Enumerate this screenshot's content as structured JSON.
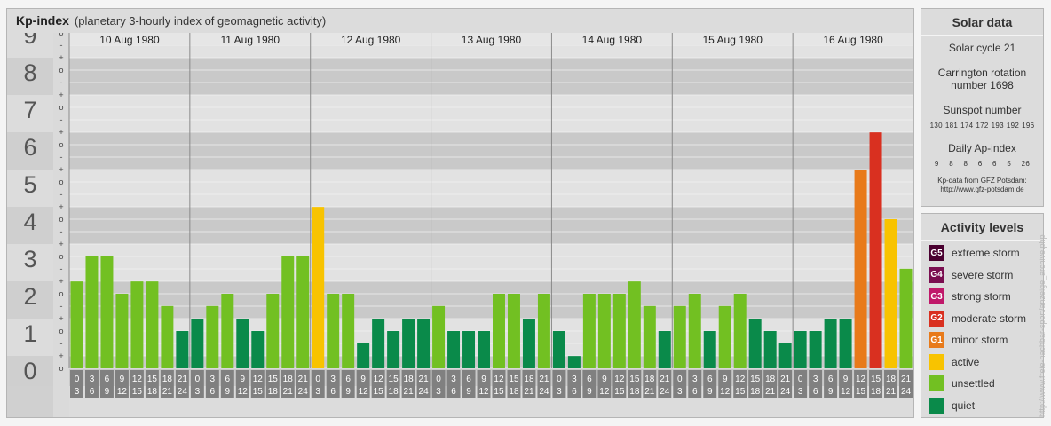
{
  "header": {
    "title": "Kp-index",
    "subtitle": "(planetary 3-hourly index of geomagnetic activity)"
  },
  "chart_data": {
    "type": "bar",
    "title": "Kp-index",
    "subtitle": "(planetary 3-hourly index of geomagnetic activity)",
    "y_major_labels": [
      "0",
      "1",
      "2",
      "3",
      "4",
      "5",
      "6",
      "7",
      "8",
      "9"
    ],
    "y_minor_marks": [
      "-",
      "o",
      "+"
    ],
    "ylim": [
      0,
      9.33
    ],
    "dates": [
      "10 Aug 1980",
      "11 Aug 1980",
      "12 Aug 1980",
      "13 Aug 1980",
      "14 Aug 1980",
      "15 Aug 1980",
      "16 Aug 1980"
    ],
    "interval_top_labels": [
      "0",
      "3",
      "6",
      "9",
      "12",
      "15",
      "18",
      "21"
    ],
    "interval_bottom_labels": [
      "3",
      "6",
      "9",
      "12",
      "15",
      "18",
      "21",
      "24"
    ],
    "values": [
      [
        2.33,
        3.0,
        3.0,
        2.0,
        2.33,
        2.33,
        1.67,
        1.0
      ],
      [
        1.33,
        1.67,
        2.0,
        1.33,
        1.0,
        2.0,
        3.0,
        3.0
      ],
      [
        4.33,
        2.0,
        2.0,
        0.67,
        1.33,
        1.0,
        1.33,
        1.33
      ],
      [
        1.67,
        1.0,
        1.0,
        1.0,
        2.0,
        2.0,
        1.33,
        2.0
      ],
      [
        1.0,
        0.33,
        2.0,
        2.0,
        2.0,
        2.33,
        1.67,
        1.0
      ],
      [
        1.67,
        2.0,
        1.0,
        1.67,
        2.0,
        1.33,
        1.0,
        0.67
      ],
      [
        1.0,
        1.0,
        1.33,
        1.33,
        5.33,
        6.33,
        4.0,
        2.67
      ]
    ],
    "level_colors": {
      "quiet": "#0a8a4a",
      "unsettled": "#72c022",
      "active": "#f8c300",
      "G1": "#e87a1a",
      "G2": "#d93020",
      "G3": "#c0186a",
      "G4": "#7a0e50",
      "G5": "#4a0030"
    },
    "grid": true
  },
  "solar_data": {
    "title": "Solar data",
    "solar_cycle": "Solar cycle 21",
    "carrington_line1": "Carrington rotation",
    "carrington_line2": "number 1698",
    "sunspot_label": "Sunspot number",
    "sunspot_values": [
      "130",
      "181",
      "174",
      "172",
      "193",
      "192",
      "196"
    ],
    "ap_label": "Daily Ap-index",
    "ap_values": [
      "9",
      "8",
      "8",
      "6",
      "6",
      "5",
      "26"
    ],
    "credit_line1": "Kp-data from GFZ Potsdam:",
    "credit_line2": "http://www.gfz-potsdam.de"
  },
  "activity_levels": {
    "title": "Activity levels",
    "items": [
      {
        "code": "G5",
        "label": "extreme storm",
        "color": "#4a0030"
      },
      {
        "code": "G4",
        "label": "severe storm",
        "color": "#7a0e50"
      },
      {
        "code": "G3",
        "label": "strong storm",
        "color": "#c0186a"
      },
      {
        "code": "G2",
        "label": "moderate storm",
        "color": "#d93020"
      },
      {
        "code": "G1",
        "label": "minor storm",
        "color": "#e87a1a"
      },
      {
        "code": "",
        "label": "active",
        "color": "#f8c300"
      },
      {
        "code": "",
        "label": "unsettled",
        "color": "#72c022"
      },
      {
        "code": "",
        "label": "quiet",
        "color": "#0a8a4a"
      }
    ]
  },
  "watermark": "http://www.freie-nachbar-sport/anzeige_archive.php"
}
